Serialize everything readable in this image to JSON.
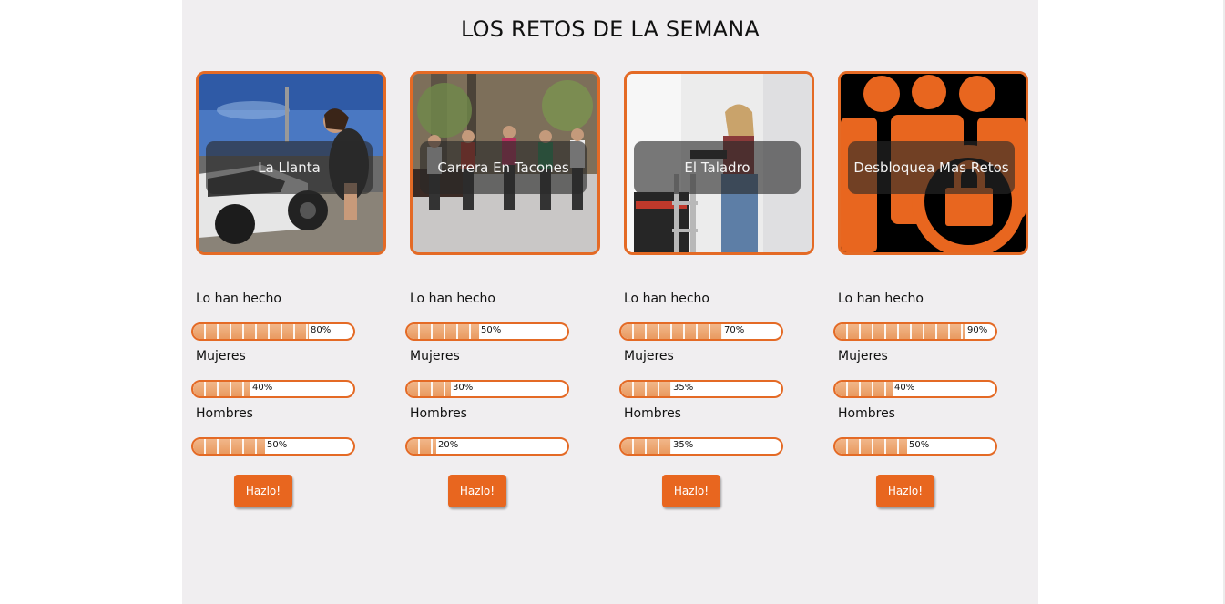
{
  "page": {
    "title": "LOS RETOS DE LA SEMANA"
  },
  "challenges": [
    {
      "name": "La Llanta",
      "stats": [
        {
          "label": "Lo han hecho",
          "value": 80,
          "text": "80%"
        },
        {
          "label": "Mujeres",
          "value": 40,
          "text": "40%"
        },
        {
          "label": "Hombres",
          "value": 50,
          "text": "50%"
        }
      ],
      "button": "Hazlo!"
    },
    {
      "name": "Carrera En Tacones",
      "stats": [
        {
          "label": "Lo han hecho",
          "value": 50,
          "text": "50%"
        },
        {
          "label": "Mujeres",
          "value": 30,
          "text": "30%"
        },
        {
          "label": "Hombres",
          "value": 20,
          "text": "20%"
        }
      ],
      "button": "Hazlo!"
    },
    {
      "name": "El Taladro",
      "stats": [
        {
          "label": "Lo han hecho",
          "value": 70,
          "text": "70%"
        },
        {
          "label": "Mujeres",
          "value": 35,
          "text": "35%"
        },
        {
          "label": "Hombres",
          "value": 35,
          "text": "35%"
        }
      ],
      "button": "Hazlo!"
    },
    {
      "name": "Desbloquea Mas Retos",
      "stats": [
        {
          "label": "Lo han hecho",
          "value": 90,
          "text": "90%"
        },
        {
          "label": "Mujeres",
          "value": 40,
          "text": "40%"
        },
        {
          "label": "Hombres",
          "value": 50,
          "text": "50%"
        }
      ],
      "button": "Hazlo!"
    }
  ],
  "colors": {
    "accent": "#e8661f",
    "panel": "#f0eef0",
    "bar_fill": "#eda06a"
  }
}
